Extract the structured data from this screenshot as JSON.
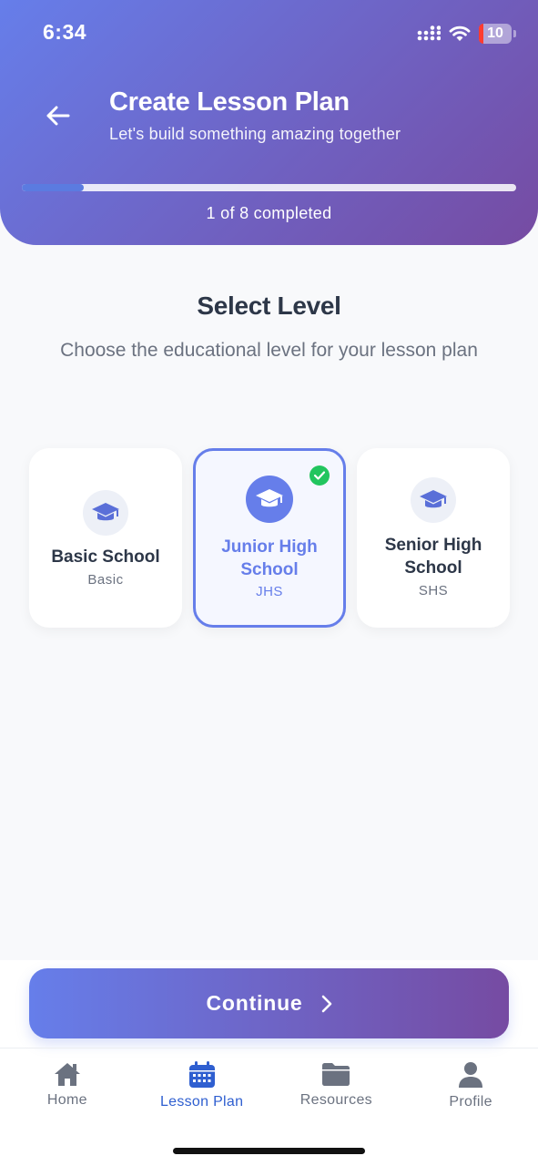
{
  "status_bar": {
    "time": "6:34",
    "battery_level": "10"
  },
  "header": {
    "title": "Create Lesson Plan",
    "subtitle": "Let's build something amazing together",
    "progress_label": "1 of 8 completed",
    "progress_fraction": 0.125
  },
  "section": {
    "title": "Select Level",
    "description": "Choose the educational level for your lesson plan"
  },
  "levels": [
    {
      "name": "Basic School",
      "code": "Basic",
      "selected": false
    },
    {
      "name": "Junior High School",
      "code": "JHS",
      "selected": true
    },
    {
      "name": "Senior High School",
      "code": "SHS",
      "selected": false
    }
  ],
  "continue_button": {
    "label": "Continue"
  },
  "tabs": [
    {
      "label": "Home",
      "icon": "home-icon",
      "active": false
    },
    {
      "label": "Lesson Plan",
      "icon": "calendar-icon",
      "active": true
    },
    {
      "label": "Resources",
      "icon": "folder-icon",
      "active": false
    },
    {
      "label": "Profile",
      "icon": "user-icon",
      "active": false
    }
  ],
  "colors": {
    "gradient_start": "#667eea",
    "gradient_end": "#764ba2",
    "selected_accent": "#667eea",
    "check_green": "#22c55e",
    "active_tab": "#2f5fd0"
  }
}
